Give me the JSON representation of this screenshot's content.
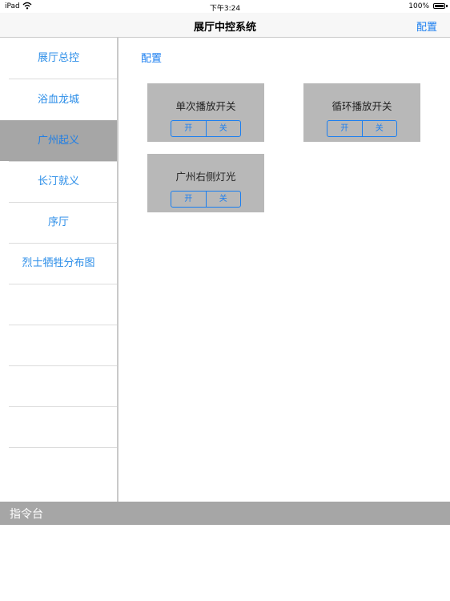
{
  "status_bar": {
    "carrier": "iPad",
    "time": "下午3:24",
    "battery": "100%"
  },
  "nav": {
    "title": "展厅中控系统",
    "config_label": "配置"
  },
  "sidebar": {
    "items": [
      {
        "label": "展厅总控",
        "selected": false
      },
      {
        "label": "浴血龙城",
        "selected": false
      },
      {
        "label": "广州起义",
        "selected": true
      },
      {
        "label": "长汀就义",
        "selected": false
      },
      {
        "label": "序厅",
        "selected": false
      },
      {
        "label": "烈士牺牲分布图",
        "selected": false
      }
    ]
  },
  "main": {
    "config_link": "配置",
    "cards": [
      {
        "title": "单次播放开关",
        "on_label": "开",
        "off_label": "关"
      },
      {
        "title": "循环播放开关",
        "on_label": "开",
        "off_label": "关"
      },
      {
        "title": "广州右侧灯光",
        "on_label": "开",
        "off_label": "关"
      }
    ]
  },
  "console": {
    "label": "指令台"
  },
  "colors": {
    "accent": "#1a7ef0",
    "selected_bg": "#a6a6a6",
    "card_bg": "#b8b8b8"
  }
}
